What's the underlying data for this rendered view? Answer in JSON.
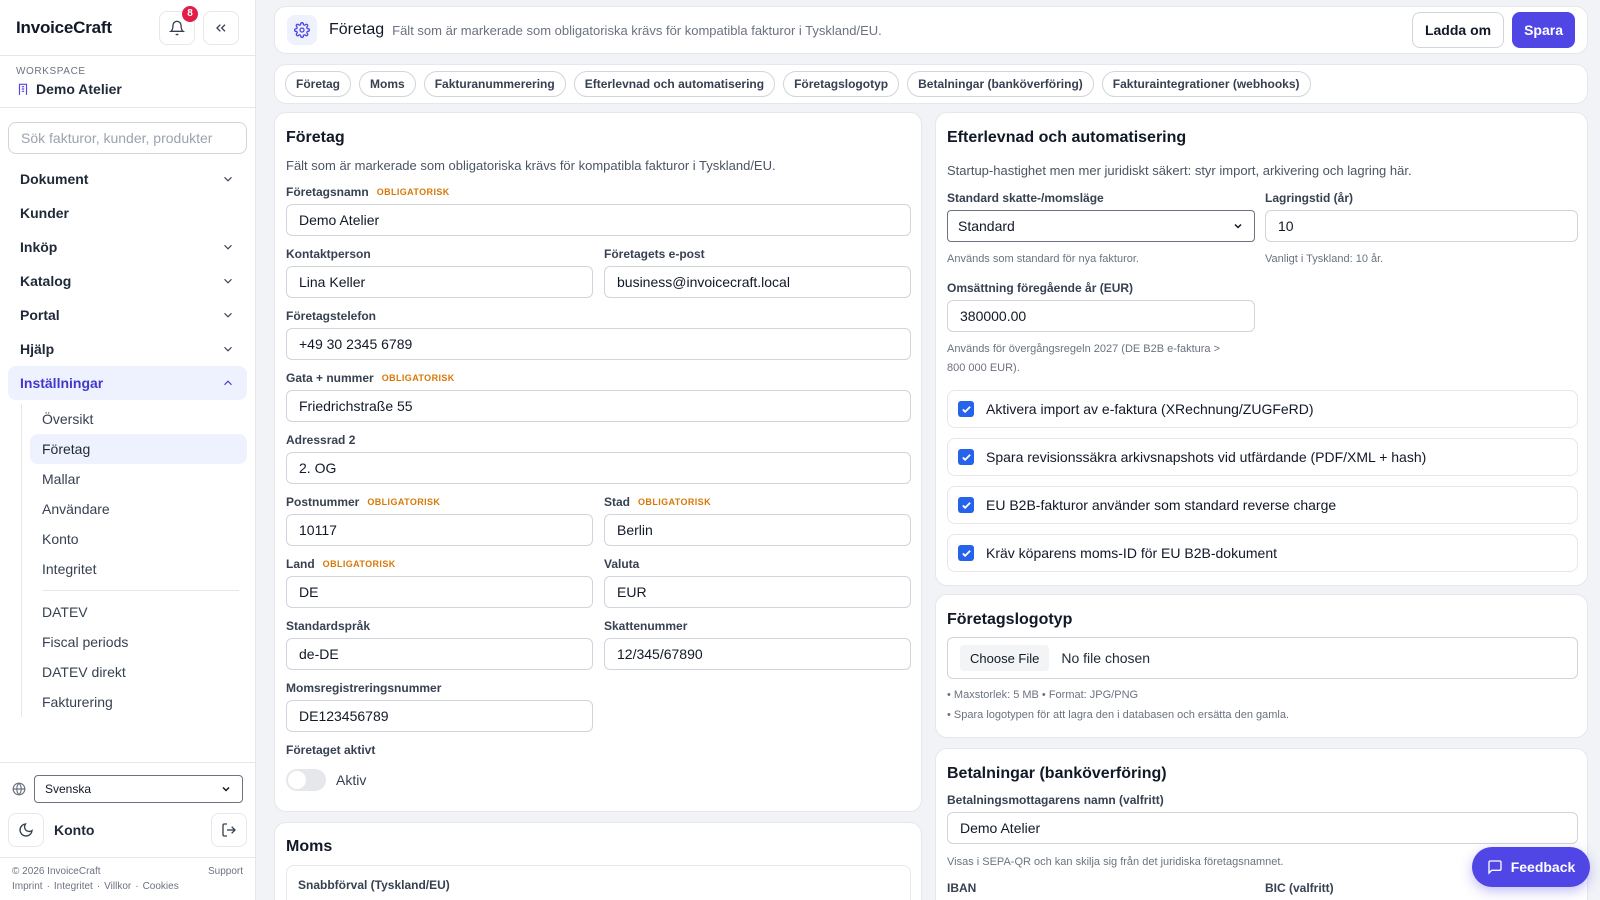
{
  "app": {
    "name": "InvoiceCraft",
    "notifications": "8"
  },
  "workspace": {
    "label": "WORKSPACE",
    "name": "Demo Atelier"
  },
  "sidebar": {
    "search_placeholder": "Sök fakturor, kunder, produkter",
    "nav": [
      {
        "label": "Dokument"
      },
      {
        "label": "Kunder"
      },
      {
        "label": "Inköp"
      },
      {
        "label": "Katalog"
      },
      {
        "label": "Portal"
      },
      {
        "label": "Hjälp"
      },
      {
        "label": "Inställningar"
      }
    ],
    "sub": [
      "Översikt",
      "Företag",
      "Mallar",
      "Användare",
      "Konto",
      "Integritet"
    ],
    "sub2": [
      "DATEV",
      "Fiscal periods",
      "DATEV direkt",
      "Fakturering"
    ],
    "language": "Svenska",
    "account": "Konto",
    "copyright": "© 2026 InvoiceCraft",
    "support": "Support",
    "legal_links": [
      "Imprint",
      "·",
      "Integritet",
      "·",
      "Villkor",
      "·",
      "Cookies"
    ]
  },
  "topbar": {
    "title": "Företag",
    "subtitle": "Fält som är markerade som obligatoriska krävs för kompatibla fakturor i Tyskland/EU.",
    "reload": "Ladda om",
    "save": "Spara"
  },
  "tabs": [
    "Företag",
    "Moms",
    "Fakturanummerering",
    "Efterlevnad och automatisering",
    "Företagslogotyp",
    "Betalningar (banköverföring)",
    "Fakturaintegrationer (webhooks)"
  ],
  "required_label": "OBLIGATORISK",
  "company": {
    "title": "Företag",
    "desc": "Fält som är markerade som obligatoriska krävs för kompatibla fakturor i Tyskland/EU.",
    "name_label": "Företagsnamn",
    "name": "Demo Atelier",
    "contact_label": "Kontaktperson",
    "contact": "Lina Keller",
    "email_label": "Företagets e-post",
    "email": "business@invoicecraft.local",
    "phone_label": "Företagstelefon",
    "phone": "+49 30 2345 6789",
    "street_label": "Gata + nummer",
    "street": "Friedrichstraße 55",
    "addr2_label": "Adressrad 2",
    "addr2": "2. OG",
    "zip_label": "Postnummer",
    "zip": "10117",
    "city_label": "Stad",
    "city": "Berlin",
    "country_label": "Land",
    "country": "DE",
    "currency_label": "Valuta",
    "currency": "EUR",
    "lang_label": "Standardspråk",
    "lang": "de-DE",
    "tax_label": "Skattenummer",
    "tax": "12/345/67890",
    "vat_label": "Momsregistreringsnummer",
    "vat": "DE123456789",
    "active_label": "Företaget aktivt",
    "active_text": "Aktiv"
  },
  "moms": {
    "title": "Moms",
    "quick_label": "Snabbförval (Tyskland/EU)"
  },
  "compliance": {
    "title": "Efterlevnad och automatisering",
    "desc": "Startup-hastighet men mer juridiskt säkert: styr import, arkivering och lagring här.",
    "tax_mode_label": "Standard skatte-/momsläge",
    "tax_mode": "Standard",
    "tax_mode_hint": "Används som standard för nya fakturor.",
    "retention_label": "Lagringstid (år)",
    "retention": "10",
    "retention_hint": "Vanligt i Tyskland: 10 år.",
    "turnover_label": "Omsättning föregående år (EUR)",
    "turnover": "380000.00",
    "turnover_hint_1": "Används för övergångsregeln 2027 (DE B2B e-faktura >",
    "turnover_hint_2": "800 000 EUR).",
    "checks": [
      "Aktivera import av e-faktura (XRechnung/ZUGFeRD)",
      "Spara revisionssäkra arkivsnapshots vid utfärdande (PDF/XML + hash)",
      "EU B2B-fakturor använder som standard reverse charge",
      "Kräv köparens moms-ID för EU B2B-dokument"
    ]
  },
  "logo": {
    "title": "Företagslogotyp",
    "choose": "Choose File",
    "no_file": "No file chosen",
    "hint1": "• Maxstorlek: 5 MB • Format: JPG/PNG",
    "hint2": "• Spara logotypen för att lagra den i databasen och ersätta den gamla."
  },
  "payments": {
    "title": "Betalningar (banköverföring)",
    "payee_label": "Betalningsmottagarens namn (valfritt)",
    "payee": "Demo Atelier",
    "payee_hint": "Visas i SEPA-QR och kan skilja sig från det juridiska företagsnamnet.",
    "iban_label": "IBAN",
    "bic_label": "BIC (valfritt)"
  },
  "feedback": "Feedback",
  "colors": {
    "primary": "#4f46e5",
    "required": "#d97706",
    "badge": "#e11d48",
    "checkbox": "#2563eb"
  }
}
